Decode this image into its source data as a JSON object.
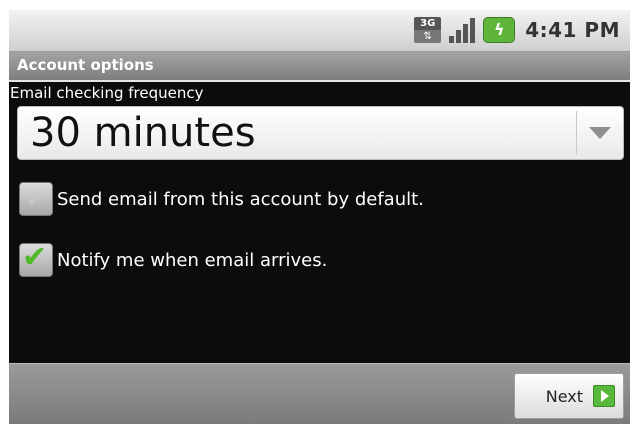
{
  "status_bar": {
    "network_label": "3G",
    "icons": [
      "3g-data-icon",
      "signal-icon",
      "battery-charging-icon"
    ],
    "time": "4:41 PM"
  },
  "title_bar": {
    "title": "Account options"
  },
  "frequency": {
    "label": "Email checking frequency",
    "selected_value": "30 minutes"
  },
  "options": [
    {
      "label": "Send email from this account by default.",
      "checked": false
    },
    {
      "label": "Notify me when email arrives.",
      "checked": true
    }
  ],
  "footer": {
    "next_label": "Next"
  },
  "colors": {
    "check_green": "#4fb92a",
    "background": "#0c0c0c",
    "title_bar": "#8f8f8f"
  }
}
